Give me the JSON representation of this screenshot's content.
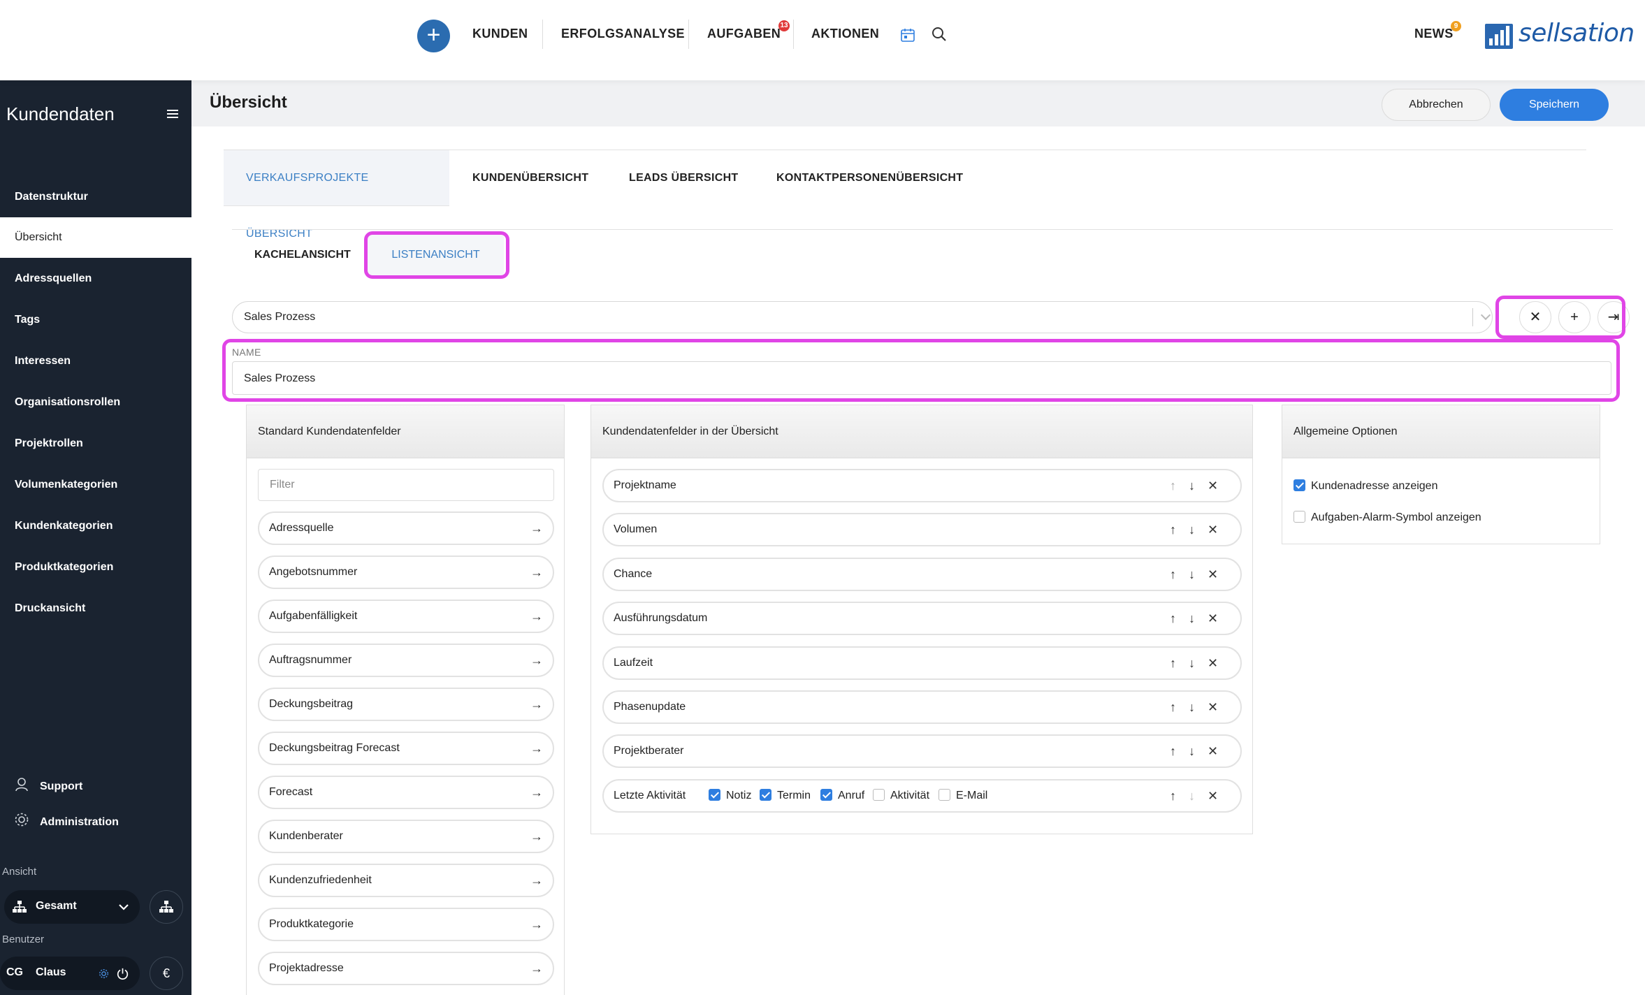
{
  "topnav": {
    "items": [
      "KUNDEN",
      "ERFOLGSANALYSE",
      "AUFGABEN",
      "AKTIONEN"
    ],
    "tasks_badge": "13",
    "news_label": "NEWS",
    "news_badge": "9",
    "logo_text": "sellsation"
  },
  "sidebar": {
    "title": "Kundendaten",
    "items": [
      "Datenstruktur",
      "Übersicht",
      "Adressquellen",
      "Tags",
      "Interessen",
      "Organisationsrollen",
      "Projektrollen",
      "Volumenkategorien",
      "Kundenkategorien",
      "Produktkategorien",
      "Druckansicht"
    ],
    "active": "Übersicht",
    "support_label": "Support",
    "admin_label": "Administration",
    "view_label": "Ansicht",
    "view_value": "Gesamt",
    "user_label": "Benutzer",
    "user_initials": "CG",
    "user_name": "Claus",
    "currency": "€"
  },
  "header": {
    "title": "Übersicht",
    "cancel_label": "Abbrechen",
    "save_label": "Speichern"
  },
  "tabs": [
    "VERKAUFSPROJEKTE ÜBERSICHT",
    "KUNDENÜBERSICHT",
    "LEADS ÜBERSICHT",
    "KONTAKTPERSONENÜBERSICHT"
  ],
  "subtabs": [
    "KACHELANSICHT",
    "LISTENANSICHT"
  ],
  "selector": {
    "value": "Sales Prozess"
  },
  "name_field": {
    "label": "NAME",
    "value": "Sales Prozess"
  },
  "standard_panel": {
    "title": "Standard Kundendatenfelder",
    "filter_placeholder": "Filter",
    "fields": [
      "Adressquelle",
      "Angebotsnummer",
      "Aufgabenfälligkeit",
      "Auftragsnummer",
      "Deckungsbeitrag",
      "Deckungsbeitrag Forecast",
      "Forecast",
      "Kundenberater",
      "Kundenzufriedenheit",
      "Produktkategorie",
      "Projektadresse"
    ]
  },
  "overview_panel": {
    "title": "Kundendatenfelder in der Übersicht",
    "fields": [
      "Projektname",
      "Volumen",
      "Chance",
      "Ausführungsdatum",
      "Laufzeit",
      "Phasenupdate",
      "Projektberater"
    ],
    "last_activity": {
      "label": "Letzte Aktivität",
      "options": [
        {
          "label": "Notiz",
          "checked": true
        },
        {
          "label": "Termin",
          "checked": true
        },
        {
          "label": "Anruf",
          "checked": true
        },
        {
          "label": "Aktivität",
          "checked": false
        },
        {
          "label": "E-Mail",
          "checked": false
        }
      ]
    }
  },
  "general_panel": {
    "title": "Allgemeine Optionen",
    "options": [
      {
        "label": "Kundenadresse anzeigen",
        "checked": true
      },
      {
        "label": "Aufgaben-Alarm-Symbol anzeigen",
        "checked": false
      }
    ]
  },
  "colors": {
    "accent": "#2e7ee0",
    "sidebar": "#1a2330",
    "highlight": "#e045e6"
  }
}
